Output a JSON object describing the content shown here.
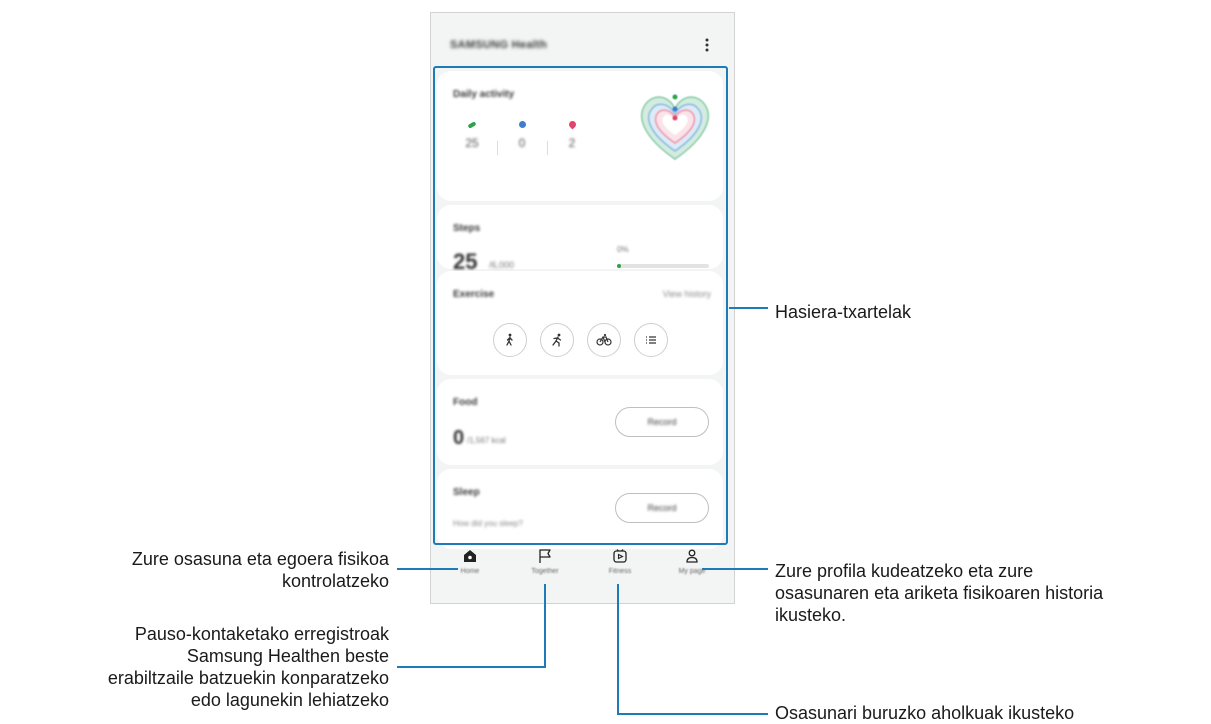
{
  "app": {
    "title": "SAMSUNG Health",
    "more_icon": "more-vertical-icon"
  },
  "cards": {
    "daily_activity": {
      "title": "Daily activity",
      "stats": [
        {
          "icon": "steps-icon",
          "value": "25",
          "color": "#2fa24c"
        },
        {
          "icon": "active-time-icon",
          "value": "0",
          "color": "#3f7fc9"
        },
        {
          "icon": "calories-icon",
          "value": "2",
          "color": "#e0456b"
        }
      ]
    },
    "steps": {
      "title": "Steps",
      "count": "25",
      "goal": "6,000",
      "percent": "0%",
      "progress": 0.04
    },
    "exercise": {
      "title": "Exercise",
      "view_history": "View history",
      "buttons": [
        "walking-icon",
        "running-icon",
        "cycling-icon",
        "list-icon"
      ]
    },
    "food": {
      "title": "Food",
      "count": "0",
      "goal": "1,567 kcal",
      "record": "Record"
    },
    "sleep": {
      "title": "Sleep",
      "question": "How did you sleep?",
      "record": "Record"
    }
  },
  "nav": [
    {
      "label": "Home",
      "icon": "home-icon"
    },
    {
      "label": "Together",
      "icon": "flag-icon"
    },
    {
      "label": "Fitness",
      "icon": "fitness-play-icon"
    },
    {
      "label": "My page",
      "icon": "person-icon"
    }
  ],
  "callouts": {
    "home_cards": "Hasiera-txartelak",
    "home": [
      "Zure osasuna eta egoera fisikoa",
      "kontrolatzeko"
    ],
    "together": [
      "Pauso-kontaketako erregistroak",
      "Samsung Healthen beste",
      "erabiltzaile batzuekin konparatzeko",
      "edo lagunekin lehiatzeko"
    ],
    "fitness": "Osasunari buruzko aholkuak ikusteko",
    "my_page": [
      "Zure profila kudeatzeko eta zure",
      "osasunaren eta ariketa fisikoaren historia",
      "ikusteko."
    ]
  },
  "colors": {
    "callout_line": "#1e7ab8",
    "accent_green": "#2fa24c"
  }
}
